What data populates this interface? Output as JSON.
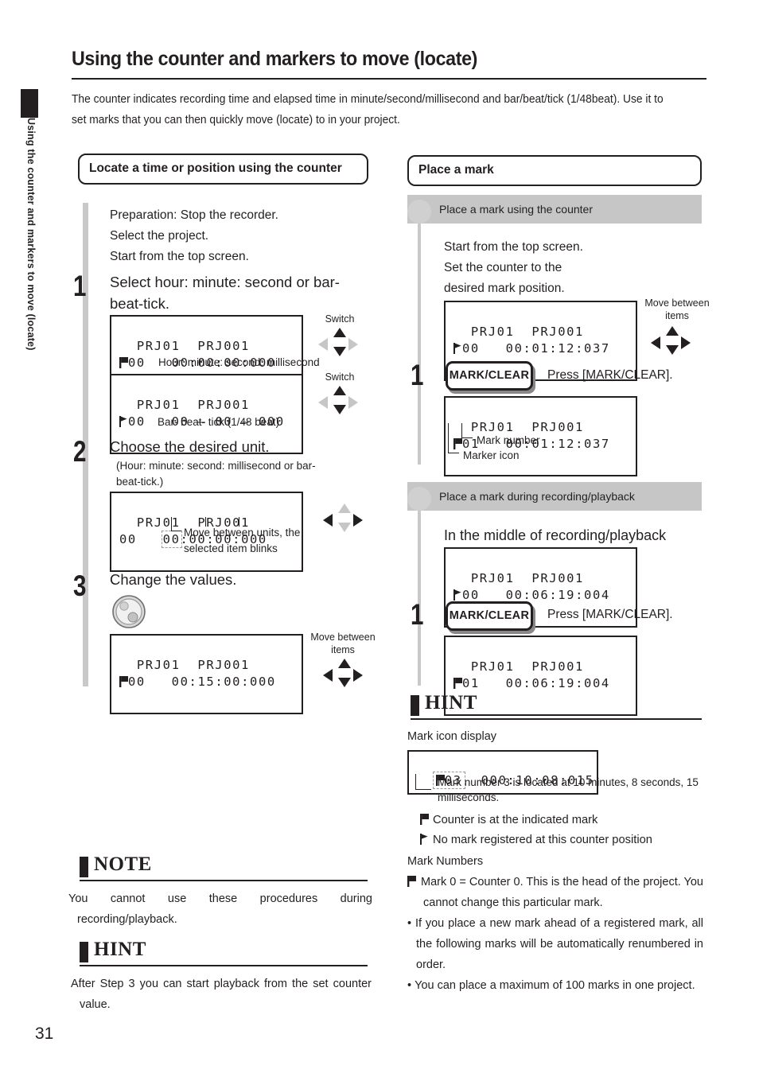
{
  "page": {
    "number": "31",
    "side_tab": "Using the counter and markers to move (locate)",
    "title": "Using the counter and markers to move (locate)",
    "intro": "The counter indicates recording time and elapsed time in minute/second/millisecond and bar/beat/tick (1/48beat). Use it to set marks that you can then quickly move (locate) to in your project."
  },
  "left": {
    "section_title": "Locate a time or position using the counter",
    "prep": [
      "Preparation: Stop the recorder.",
      "Select the project.",
      "Start from the top screen."
    ],
    "step1": {
      "num": "1",
      "text": "Select hour: minute: second or bar-beat-tick.",
      "lcd_a": {
        "line1": "PRJ01  PRJ001",
        "icon": "mark-filled",
        "line2": "00   00:00:00:000"
      },
      "caption_a": "Hour: minute: second: millisecond",
      "lcd_b": {
        "line1": "PRJ01  PRJ001",
        "icon": "mark-outline",
        "line2": "00   00 – 00 – 000"
      },
      "caption_b": "Bar- beat- tick (1/48 beat)",
      "switch_label_a": "Switch",
      "switch_label_b": "Switch"
    },
    "step2": {
      "num": "2",
      "text": "Choose the desired unit.",
      "sub": "(Hour: minute: second: millisecond or bar-beat-tick.)",
      "lcd": {
        "line1": "PRJ01  PRJ001",
        "line2_pre": "00   ",
        "line2_hl": "00",
        "line2_post": ":00:00:000"
      },
      "note": "Move between units, the selected item blinks"
    },
    "step3": {
      "num": "3",
      "text": "Change the values.",
      "knob": "dial-knob",
      "lcd": {
        "line1": "PRJ01  PRJ001",
        "icon": "mark-filled",
        "line2": "00   00:15:00:000"
      },
      "arrow_label": "Move between items"
    },
    "note_block": {
      "heading": "NOTE",
      "items": [
        "You cannot use these procedures during recording/playback."
      ]
    },
    "hint_block": {
      "heading": "HINT",
      "items": [
        "After Step 3 you can start playback from the set counter value."
      ]
    }
  },
  "right": {
    "section_title": "Place a mark",
    "sub1": {
      "bar": "Place a mark using the counter",
      "lines": [
        "Start from the top screen.",
        "Set the counter to the",
        "desired mark position."
      ],
      "lcd_before": {
        "line1": "PRJ01  PRJ001",
        "icon": "mark-outline",
        "line2": "00   00:01:12:037"
      },
      "arrow_label": "Move between items",
      "step": {
        "num": "1",
        "key": "MARK/CLEAR",
        "press": "Press [MARK/CLEAR]."
      },
      "lcd_after": {
        "line1": "PRJ01  PRJ001",
        "icon": "mark-filled",
        "line2": "01   00:01:12:037"
      },
      "callout_mark_number": "Mark number",
      "callout_marker_icon": "Marker icon"
    },
    "sub2": {
      "bar": "Place a mark during recording/playback",
      "heading": "In the middle of recording/playback",
      "lcd_before": {
        "line1": "PRJ01  PRJ001",
        "icon": "mark-outline",
        "line2": "00   00:06:19:004"
      },
      "step": {
        "num": "1",
        "key": "MARK/CLEAR",
        "press": "Press [MARK/CLEAR]."
      },
      "lcd_after": {
        "line1": "PRJ01  PRJ001",
        "icon": "mark-filled",
        "line2": "01   00:06:19:004"
      }
    },
    "hint_block": {
      "heading": "HINT",
      "lead": "Mark icon display",
      "lcd": {
        "icon": "mark-filled",
        "hl": "03",
        "rest": "  000:10:08:015"
      },
      "lcd_caption": "Mark number 3 is located at 10 minutes, 8 seconds, 15 milliseconds.",
      "legend": [
        {
          "icon": "mark-filled",
          "text": "Counter is at the indicated mark"
        },
        {
          "icon": "mark-outline",
          "text": "No mark registered at this counter position"
        }
      ],
      "mark_numbers_label": "Mark Numbers",
      "items": [
        {
          "icon": "mark-filled",
          "text": "Mark 0 = Counter 0. This is the head of the project. You cannot change this particular mark."
        },
        {
          "icon": "bullet",
          "text": "If you place a new mark ahead of a registered mark, all the following marks will be automatically renumbered in order."
        },
        {
          "icon": "bullet",
          "text": "You can place a maximum of 100 marks in one project."
        }
      ]
    }
  },
  "colors": {
    "ink": "#231f20",
    "gray_bar": "#c6c6c6",
    "rule": "#c9c9c9"
  }
}
